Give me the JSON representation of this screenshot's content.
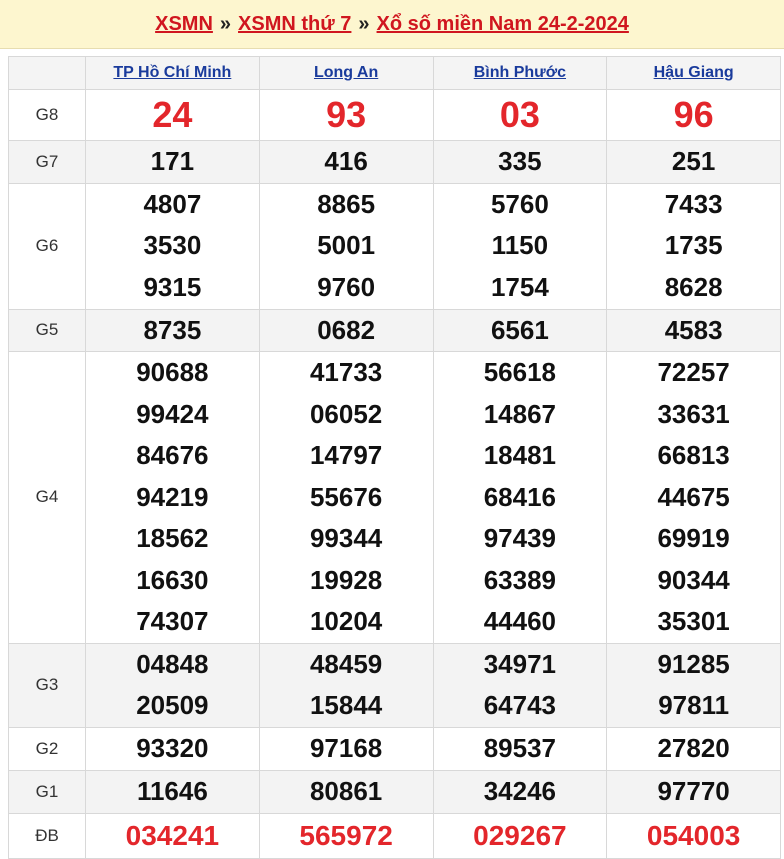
{
  "header": {
    "crumb1": "XSMN",
    "crumb2": "XSMN thứ 7",
    "crumb3": "Xổ số miền Nam 24-2-2024",
    "separator": "»"
  },
  "provinces": [
    "TP Hồ Chí Minh",
    "Long An",
    "Bình Phước",
    "Hậu Giang"
  ],
  "prizes": [
    {
      "label": "G8",
      "results": [
        [
          "24"
        ],
        [
          "93"
        ],
        [
          "03"
        ],
        [
          "96"
        ]
      ]
    },
    {
      "label": "G7",
      "results": [
        [
          "171"
        ],
        [
          "416"
        ],
        [
          "335"
        ],
        [
          "251"
        ]
      ]
    },
    {
      "label": "G6",
      "results": [
        [
          "4807",
          "3530",
          "9315"
        ],
        [
          "8865",
          "5001",
          "9760"
        ],
        [
          "5760",
          "1150",
          "1754"
        ],
        [
          "7433",
          "1735",
          "8628"
        ]
      ]
    },
    {
      "label": "G5",
      "results": [
        [
          "8735"
        ],
        [
          "0682"
        ],
        [
          "6561"
        ],
        [
          "4583"
        ]
      ]
    },
    {
      "label": "G4",
      "results": [
        [
          "90688",
          "99424",
          "84676",
          "94219",
          "18562",
          "16630",
          "74307"
        ],
        [
          "41733",
          "06052",
          "14797",
          "55676",
          "99344",
          "19928",
          "10204"
        ],
        [
          "56618",
          "14867",
          "18481",
          "68416",
          "97439",
          "63389",
          "44460"
        ],
        [
          "72257",
          "33631",
          "66813",
          "44675",
          "69919",
          "90344",
          "35301"
        ]
      ]
    },
    {
      "label": "G3",
      "results": [
        [
          "04848",
          "20509"
        ],
        [
          "48459",
          "15844"
        ],
        [
          "34971",
          "64743"
        ],
        [
          "91285",
          "97811"
        ]
      ]
    },
    {
      "label": "G2",
      "results": [
        [
          "93320"
        ],
        [
          "97168"
        ],
        [
          "89537"
        ],
        [
          "27820"
        ]
      ]
    },
    {
      "label": "G1",
      "results": [
        [
          "11646"
        ],
        [
          "80861"
        ],
        [
          "34246"
        ],
        [
          "97770"
        ]
      ]
    },
    {
      "label": "ĐB",
      "results": [
        [
          "034241"
        ],
        [
          "565972"
        ],
        [
          "029267"
        ],
        [
          "054003"
        ]
      ]
    }
  ],
  "colors": {
    "accent_red": "#e3262b",
    "link_blue": "#1a3b9c",
    "header_bg": "#fdf6cf"
  }
}
